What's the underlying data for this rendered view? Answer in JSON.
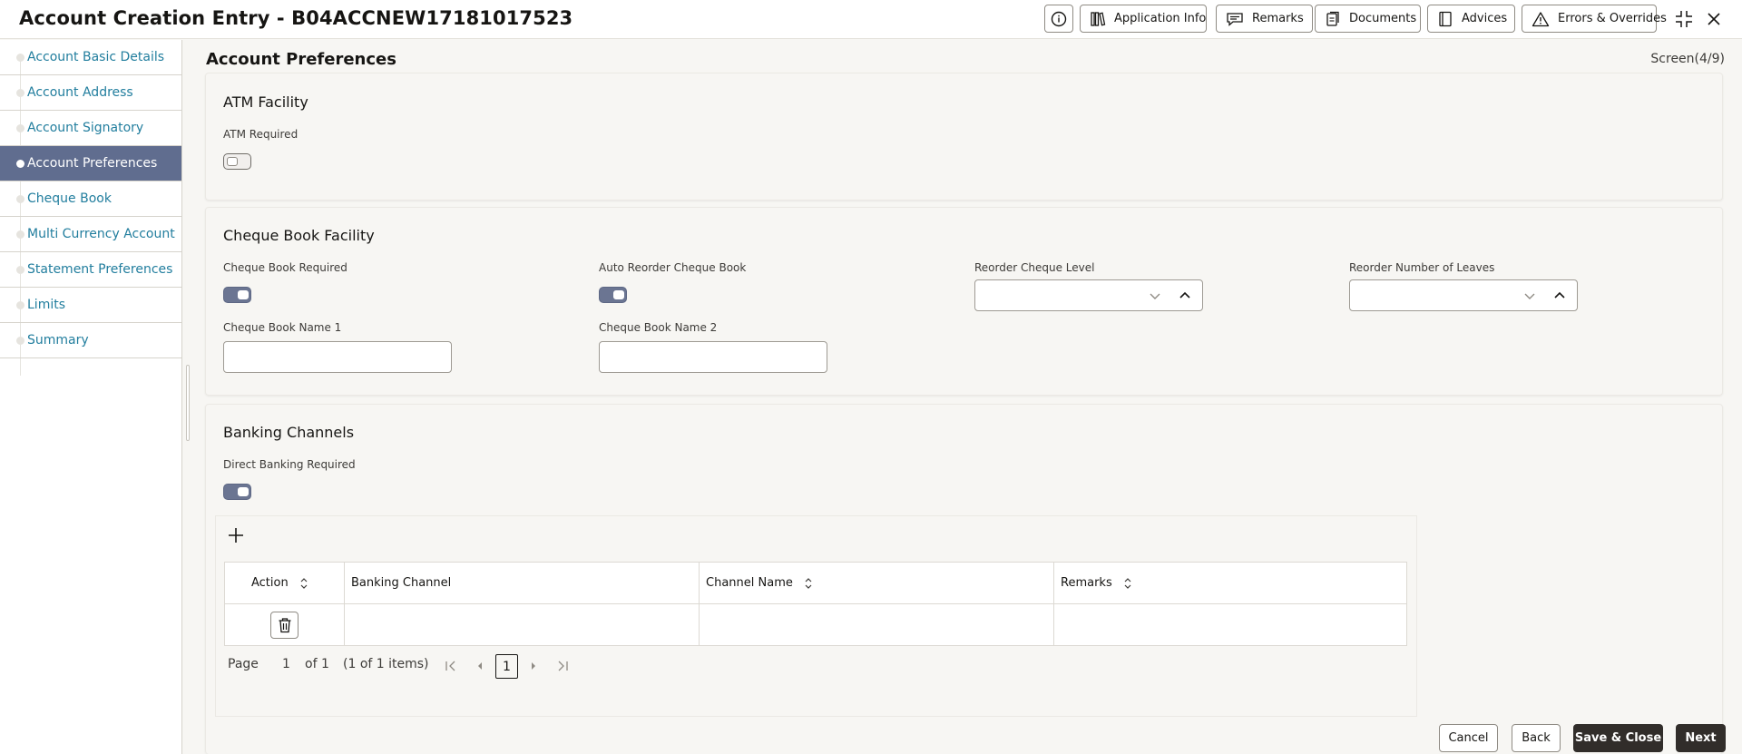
{
  "header": {
    "title": "Account Creation Entry - B04ACCNEW17181017523",
    "buttons": {
      "application_info": "Application Info",
      "remarks": "Remarks",
      "documents": "Documents",
      "advices": "Advices",
      "errors": "Errors & Overrides"
    }
  },
  "sidebar": {
    "items": [
      {
        "label": "Account Basic Details",
        "active": false
      },
      {
        "label": "Account Address",
        "active": false
      },
      {
        "label": "Account Signatory",
        "active": false
      },
      {
        "label": "Account Preferences",
        "active": true
      },
      {
        "label": "Cheque Book",
        "active": false
      },
      {
        "label": "Multi Currency Account",
        "active": false
      },
      {
        "label": "Statement Preferences",
        "active": false
      },
      {
        "label": "Limits",
        "active": false
      },
      {
        "label": "Summary",
        "active": false
      }
    ]
  },
  "main": {
    "title": "Account Preferences",
    "screen": "Screen(4/9)",
    "atm": {
      "title": "ATM Facility",
      "atm_required_label": "ATM Required",
      "atm_required": false
    },
    "cheque": {
      "title": "Cheque Book Facility",
      "required_label": "Cheque Book Required",
      "required": true,
      "auto_reorder_label": "Auto Reorder Cheque Book",
      "auto_reorder": true,
      "reorder_level_label": "Reorder Cheque Level",
      "reorder_level_value": "",
      "reorder_leaves_label": "Reorder Number of Leaves",
      "reorder_leaves_value": "",
      "name1_label": "Cheque Book Name 1",
      "name1_value": "",
      "name2_label": "Cheque Book Name 2",
      "name2_value": ""
    },
    "banking": {
      "title": "Banking Channels",
      "direct_label": "Direct Banking Required",
      "direct": true,
      "table": {
        "columns": [
          "Action",
          "Banking Channel",
          "Channel Name",
          "Remarks"
        ],
        "rows": [
          {
            "banking_channel": "",
            "channel_name": "",
            "remarks": ""
          }
        ]
      },
      "pager": {
        "page_label": "Page",
        "page": "1",
        "of": "of 1",
        "items": "(1 of 1 items)",
        "current": "1"
      }
    }
  },
  "footer": {
    "cancel": "Cancel",
    "back": "Back",
    "save_close": "Save & Close",
    "next": "Next"
  },
  "colors": {
    "accent": "#606d8f",
    "link": "#227e9e",
    "primary_button": "#312d2a"
  }
}
